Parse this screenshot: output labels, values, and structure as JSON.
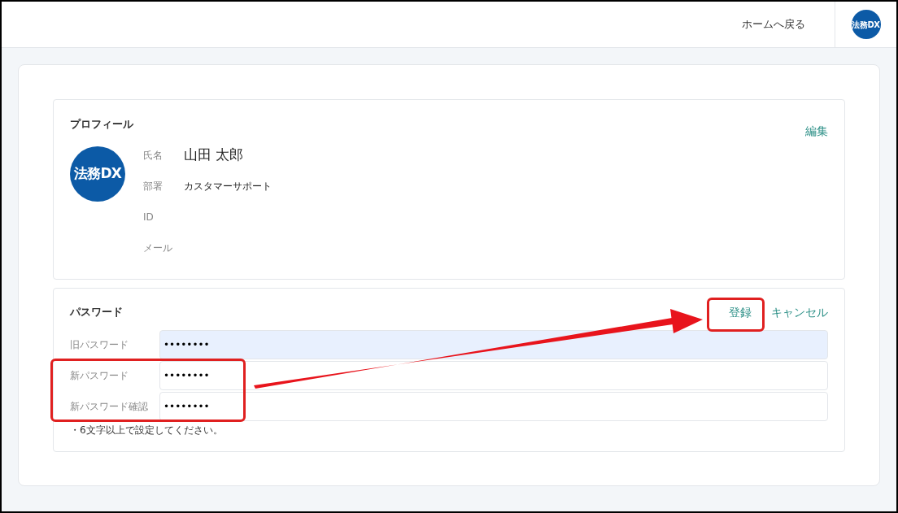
{
  "header": {
    "home_link": "ホームへ戻る",
    "logo": "法務DX"
  },
  "profile": {
    "title": "プロフィール",
    "edit": "編集",
    "avatar": "法務DX",
    "fields": [
      {
        "label": "氏名",
        "value": "山田 太郎",
        "kind": "large"
      },
      {
        "label": "部署",
        "value": "カスタマーサポート",
        "kind": "normal"
      },
      {
        "label": "ID"
      },
      {
        "label": "メール"
      }
    ]
  },
  "password": {
    "title": "パスワード",
    "register": "登録",
    "cancel": "キャンセル",
    "fields": [
      {
        "label": "旧パスワード",
        "value": "••••••••",
        "autofilled": true
      },
      {
        "label": "新パスワード",
        "value": "••••••••",
        "autofilled": false
      },
      {
        "label": "新パスワード確認",
        "value": "••••••••",
        "autofilled": false
      }
    ],
    "note": "・6文字以上で設定してください。"
  }
}
